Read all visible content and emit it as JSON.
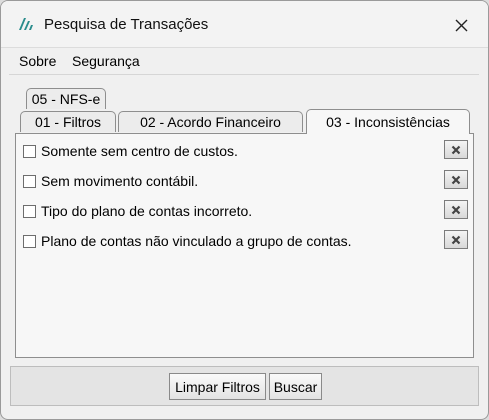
{
  "window": {
    "title": "Pesquisa de Transações"
  },
  "menu": {
    "sobre": "Sobre",
    "seguranca": "Segurança"
  },
  "tabs": [
    {
      "label": "05 - NFS-e"
    },
    {
      "label": "01 - Filtros"
    },
    {
      "label": "02 - Acordo Financeiro"
    },
    {
      "label": "03 - Inconsistências",
      "active": true
    }
  ],
  "options": [
    {
      "label": "Somente sem centro de custos."
    },
    {
      "label": "Sem movimento contábil."
    },
    {
      "label": "Tipo do plano de contas incorreto."
    },
    {
      "label": "Plano de contas não vinculado a grupo de contas."
    }
  ],
  "buttons": {
    "limpar": "Limpar Filtros",
    "buscar": "Buscar"
  },
  "colors": {
    "window_bg": "#f0f0f0",
    "panel_bg": "#f7f7f7",
    "border": "#8e8e8e"
  },
  "icons": [
    "app-logo-icon",
    "close-icon",
    "clear-x-icon"
  ]
}
